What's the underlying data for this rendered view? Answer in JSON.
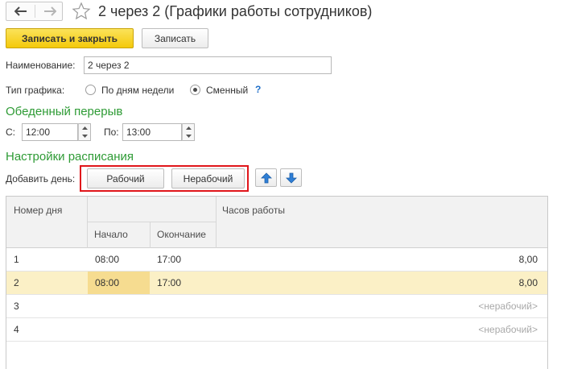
{
  "window": {
    "title": "2 через 2 (Графики работы сотрудников)",
    "icons": {
      "back": "arrow-left-icon",
      "forward": "arrow-right-icon",
      "favorite": "star-icon"
    }
  },
  "toolbar": {
    "save_close_label": "Записать и закрыть",
    "save_label": "Записать"
  },
  "form": {
    "name_label": "Наименование:",
    "name_value": "2 через 2",
    "schedule_type_label": "Тип графика:",
    "schedule_type_options": [
      {
        "label": "По дням недели",
        "selected": false
      },
      {
        "label": "Сменный",
        "selected": true
      }
    ],
    "help_label": "?"
  },
  "lunch_break": {
    "section_title": "Обеденный перерыв",
    "from_label": "С:",
    "from_value": "12:00",
    "to_label": "По:",
    "to_value": "13:00"
  },
  "schedule_settings": {
    "section_title": "Настройки расписания",
    "add_day_label": "Добавить день:",
    "working_button": "Рабочий",
    "nonworking_button": "Нерабочий",
    "icons": {
      "move_up": "arrow-up-icon",
      "move_down": "arrow-down-icon"
    }
  },
  "table": {
    "headers": {
      "day_number": "Номер дня",
      "start": "Начало",
      "end": "Окончание",
      "hours": "Часов работы"
    },
    "rows": [
      {
        "day": "1",
        "start": "08:00",
        "end": "17:00",
        "hours": "8,00",
        "selected": false
      },
      {
        "day": "2",
        "start": "08:00",
        "end": "17:00",
        "hours": "8,00",
        "selected": true
      },
      {
        "day": "3",
        "start": "",
        "end": "",
        "hours": "<нерабочий>",
        "selected": false
      },
      {
        "day": "4",
        "start": "",
        "end": "",
        "hours": "<нерабочий>",
        "selected": false
      }
    ]
  },
  "colors": {
    "accent_yellow": "#f4c90b",
    "section_green": "#2e9b35",
    "highlight_red": "#e0161b",
    "selected_row": "#fbf0c6",
    "current_cell": "#f6dc90"
  }
}
